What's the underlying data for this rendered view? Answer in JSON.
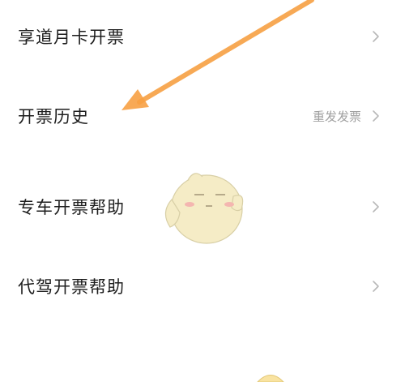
{
  "menu": {
    "items": [
      {
        "label": "享道月卡开票",
        "sub": ""
      },
      {
        "label": "开票历史",
        "sub": "重发发票"
      },
      {
        "label": "专车开票帮助",
        "sub": ""
      },
      {
        "label": "代驾开票帮助",
        "sub": ""
      }
    ]
  },
  "colors": {
    "text": "#1e1e1e",
    "subtext": "#a0a0a0",
    "chevron": "#b8b8b8",
    "annotation_arrow": "#f7a043",
    "sticker_body": "#f5ecc6"
  },
  "icons": {
    "chevron": "chevron-right-icon",
    "arrow": "annotation-arrow",
    "sticker": "chick-sticker"
  }
}
